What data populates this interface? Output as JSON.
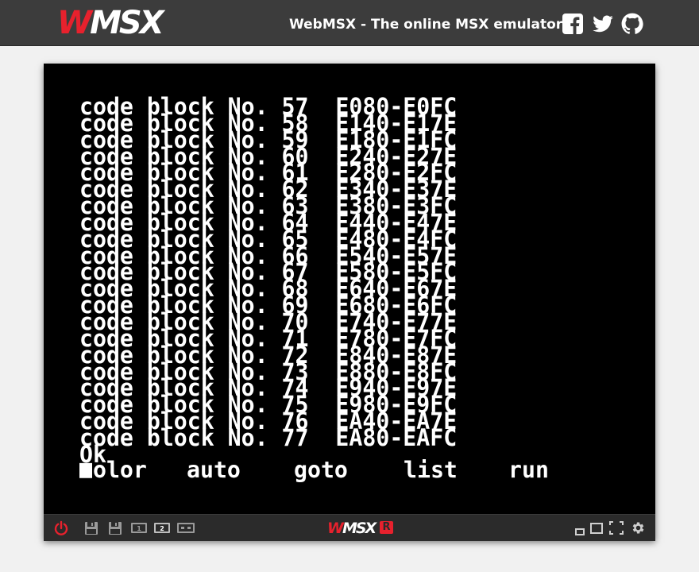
{
  "site": {
    "logo_w": "W",
    "logo_msx": "MSX",
    "title": "WebMSX - The online MSX emulator",
    "social": [
      "facebook-icon",
      "twitter-icon",
      "github-icon"
    ]
  },
  "screen": {
    "rows": [
      "code block No. 57  E080-E0FC",
      "code block No. 58  E140-E17E",
      "code block No. 59  E180-E1FC",
      "code block No. 60  E240-E27E",
      "code block No. 61  E280-E2FC",
      "code block No. 62  E340-E37E",
      "code block No. 63  E380-E3FC",
      "code block No. 64  E440-E47E",
      "code block No. 65  E480-E4FC",
      "code block No. 66  E540-E57E",
      "code block No. 67  E580-E5FC",
      "code block No. 68  E640-E67E",
      "code block No. 69  E680-E6FC",
      "code block No. 70  E740-E77E",
      "code block No. 71  E780-E7FC",
      "code block No. 72  E840-E87E",
      "code block No. 73  E880-E8FC",
      "code block No. 74  E940-E97E",
      "code block No. 75  E980-E9FC",
      "code block No. 76  EA40-EA7E",
      "code block No. 77  EA80-EAFC",
      "Ok"
    ],
    "function_keys": [
      "color",
      "auto",
      "goto",
      "list",
      "run"
    ]
  },
  "bottom_bar": {
    "logo_w": "W",
    "logo_msx": "MSX",
    "badge": "R",
    "disk_labels": [
      "1",
      "2"
    ]
  },
  "colors": {
    "accent": "#e7212d",
    "topbar": "#3c3c3c",
    "bottombar": "#2b2b2b"
  }
}
